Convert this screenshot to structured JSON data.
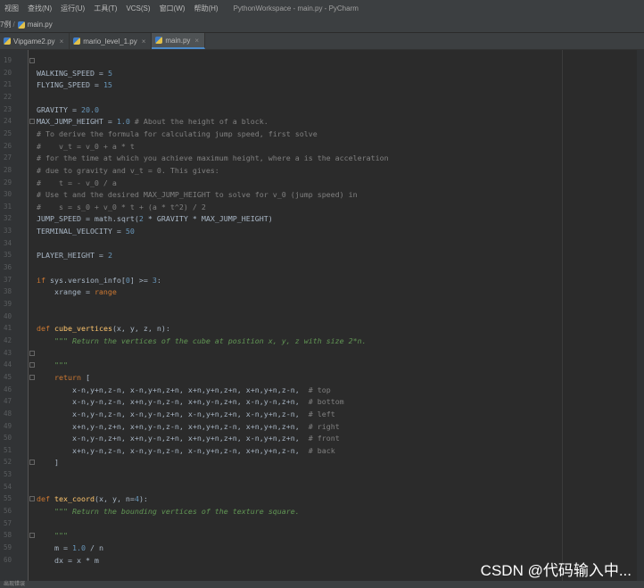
{
  "menubar": {
    "items": [
      "视图",
      "查找(N)",
      "运行(U)",
      "工具(T)",
      "VCS(S)",
      "窗口(W)",
      "帮助(H)"
    ],
    "window_title": "PythonWorkspace - main.py - PyCharm"
  },
  "breadcrumb": {
    "prefix": "7例",
    "file": "main.py"
  },
  "tabs": [
    {
      "label": "Vipgame2.py",
      "active": false
    },
    {
      "label": "mario_level_1.py",
      "active": false
    },
    {
      "label": "main.py",
      "active": true
    }
  ],
  "close_glyph": "×",
  "editor": {
    "first_line_number": 19,
    "lines": [
      [
        [
          "",
          "    "
        ]
      ],
      [
        [
          "",
          "WALKING_SPEED = "
        ],
        [
          "num",
          "5"
        ]
      ],
      [
        [
          "",
          "FLYING_SPEED = "
        ],
        [
          "num",
          "15"
        ]
      ],
      [
        [
          "",
          ""
        ]
      ],
      [
        [
          "",
          "GRAVITY = "
        ],
        [
          "num",
          "20.0"
        ]
      ],
      [
        [
          "",
          "MAX_JUMP_HEIGHT = "
        ],
        [
          "num",
          "1.0"
        ],
        [
          "cm",
          " # About the height of a block."
        ]
      ],
      [
        [
          "cm",
          "# To derive the formula for calculating jump speed, first solve"
        ]
      ],
      [
        [
          "cm",
          "#    v_t = v_0 + a * t"
        ]
      ],
      [
        [
          "cm",
          "# for the time at which you achieve maximum height, where a is the acceleration"
        ]
      ],
      [
        [
          "cm",
          "# due to gravity and v_t = 0. This gives:"
        ]
      ],
      [
        [
          "cm",
          "#    t = - v_0 / a"
        ]
      ],
      [
        [
          "cm",
          "# Use t and the desired MAX_JUMP_HEIGHT to solve for v_0 (jump speed) in"
        ]
      ],
      [
        [
          "cm",
          "#    s = s_0 + v_0 * t + (a * t^2) / 2"
        ]
      ],
      [
        [
          "",
          "JUMP_SPEED = math.sqrt("
        ],
        [
          "num",
          "2"
        ],
        [
          "",
          " * GRAVITY * MAX_JUMP_HEIGHT)"
        ]
      ],
      [
        [
          "",
          "TERMINAL_VELOCITY = "
        ],
        [
          "num",
          "50"
        ]
      ],
      [
        [
          "",
          ""
        ]
      ],
      [
        [
          "",
          "PLAYER_HEIGHT = "
        ],
        [
          "num",
          "2"
        ]
      ],
      [
        [
          "",
          ""
        ]
      ],
      [
        [
          "kw",
          "if"
        ],
        [
          "",
          " sys.version_info["
        ],
        [
          "num",
          "0"
        ],
        [
          "",
          "] >= "
        ],
        [
          "num",
          "3"
        ],
        [
          "",
          ":"
        ]
      ],
      [
        [
          "",
          "    xrange = "
        ],
        [
          "kw",
          "range"
        ]
      ],
      [
        [
          "",
          ""
        ]
      ],
      [
        [
          "",
          ""
        ]
      ],
      [
        [
          "kw",
          "def"
        ],
        [
          "",
          " "
        ],
        [
          "fn",
          "cube_vertices"
        ],
        [
          "",
          "(x, y, z, n):"
        ]
      ],
      [
        [
          "doc",
          "    \"\"\" Return the vertices of the cube at position x, y, z with size 2*n."
        ]
      ],
      [
        [
          "",
          ""
        ]
      ],
      [
        [
          "doc",
          "    \"\"\""
        ]
      ],
      [
        [
          "",
          "    "
        ],
        [
          "kw",
          "return"
        ],
        [
          "",
          " ["
        ]
      ],
      [
        [
          "",
          "        x-n,y+n,z-n, x-n,y+n,z+n, x+n,y+n,z+n, x+n,y+n,z-n,  "
        ],
        [
          "cm",
          "# top"
        ]
      ],
      [
        [
          "",
          "        x-n,y-n,z-n, x+n,y-n,z-n, x+n,y-n,z+n, x-n,y-n,z+n,  "
        ],
        [
          "cm",
          "# bottom"
        ]
      ],
      [
        [
          "",
          "        x-n,y-n,z-n, x-n,y-n,z+n, x-n,y+n,z+n, x-n,y+n,z-n,  "
        ],
        [
          "cm",
          "# left"
        ]
      ],
      [
        [
          "",
          "        x+n,y-n,z+n, x+n,y-n,z-n, x+n,y+n,z-n, x+n,y+n,z+n,  "
        ],
        [
          "cm",
          "# right"
        ]
      ],
      [
        [
          "",
          "        x-n,y-n,z+n, x+n,y-n,z+n, x+n,y+n,z+n, x-n,y+n,z+n,  "
        ],
        [
          "cm",
          "# front"
        ]
      ],
      [
        [
          "",
          "        x+n,y-n,z-n, x-n,y-n,z-n, x-n,y+n,z-n, x+n,y+n,z-n,  "
        ],
        [
          "cm",
          "# back"
        ]
      ],
      [
        [
          "",
          "    ]"
        ]
      ],
      [
        [
          "",
          ""
        ]
      ],
      [
        [
          "",
          ""
        ]
      ],
      [
        [
          "kw",
          "def"
        ],
        [
          "",
          " "
        ],
        [
          "fn",
          "tex_coord"
        ],
        [
          "",
          "(x, y, n="
        ],
        [
          "num",
          "4"
        ],
        [
          "",
          "):"
        ]
      ],
      [
        [
          "doc",
          "    \"\"\" Return the bounding vertices of the texture square."
        ]
      ],
      [
        [
          "",
          ""
        ]
      ],
      [
        [
          "doc",
          "    \"\"\""
        ]
      ],
      [
        [
          "",
          "    m = "
        ],
        [
          "num",
          "1.0"
        ],
        [
          "",
          " / n"
        ]
      ],
      [
        [
          "",
          "    dx = x * m"
        ]
      ]
    ]
  },
  "watermark": "CSDN @代码输入中...",
  "statusbar": "出现错误"
}
